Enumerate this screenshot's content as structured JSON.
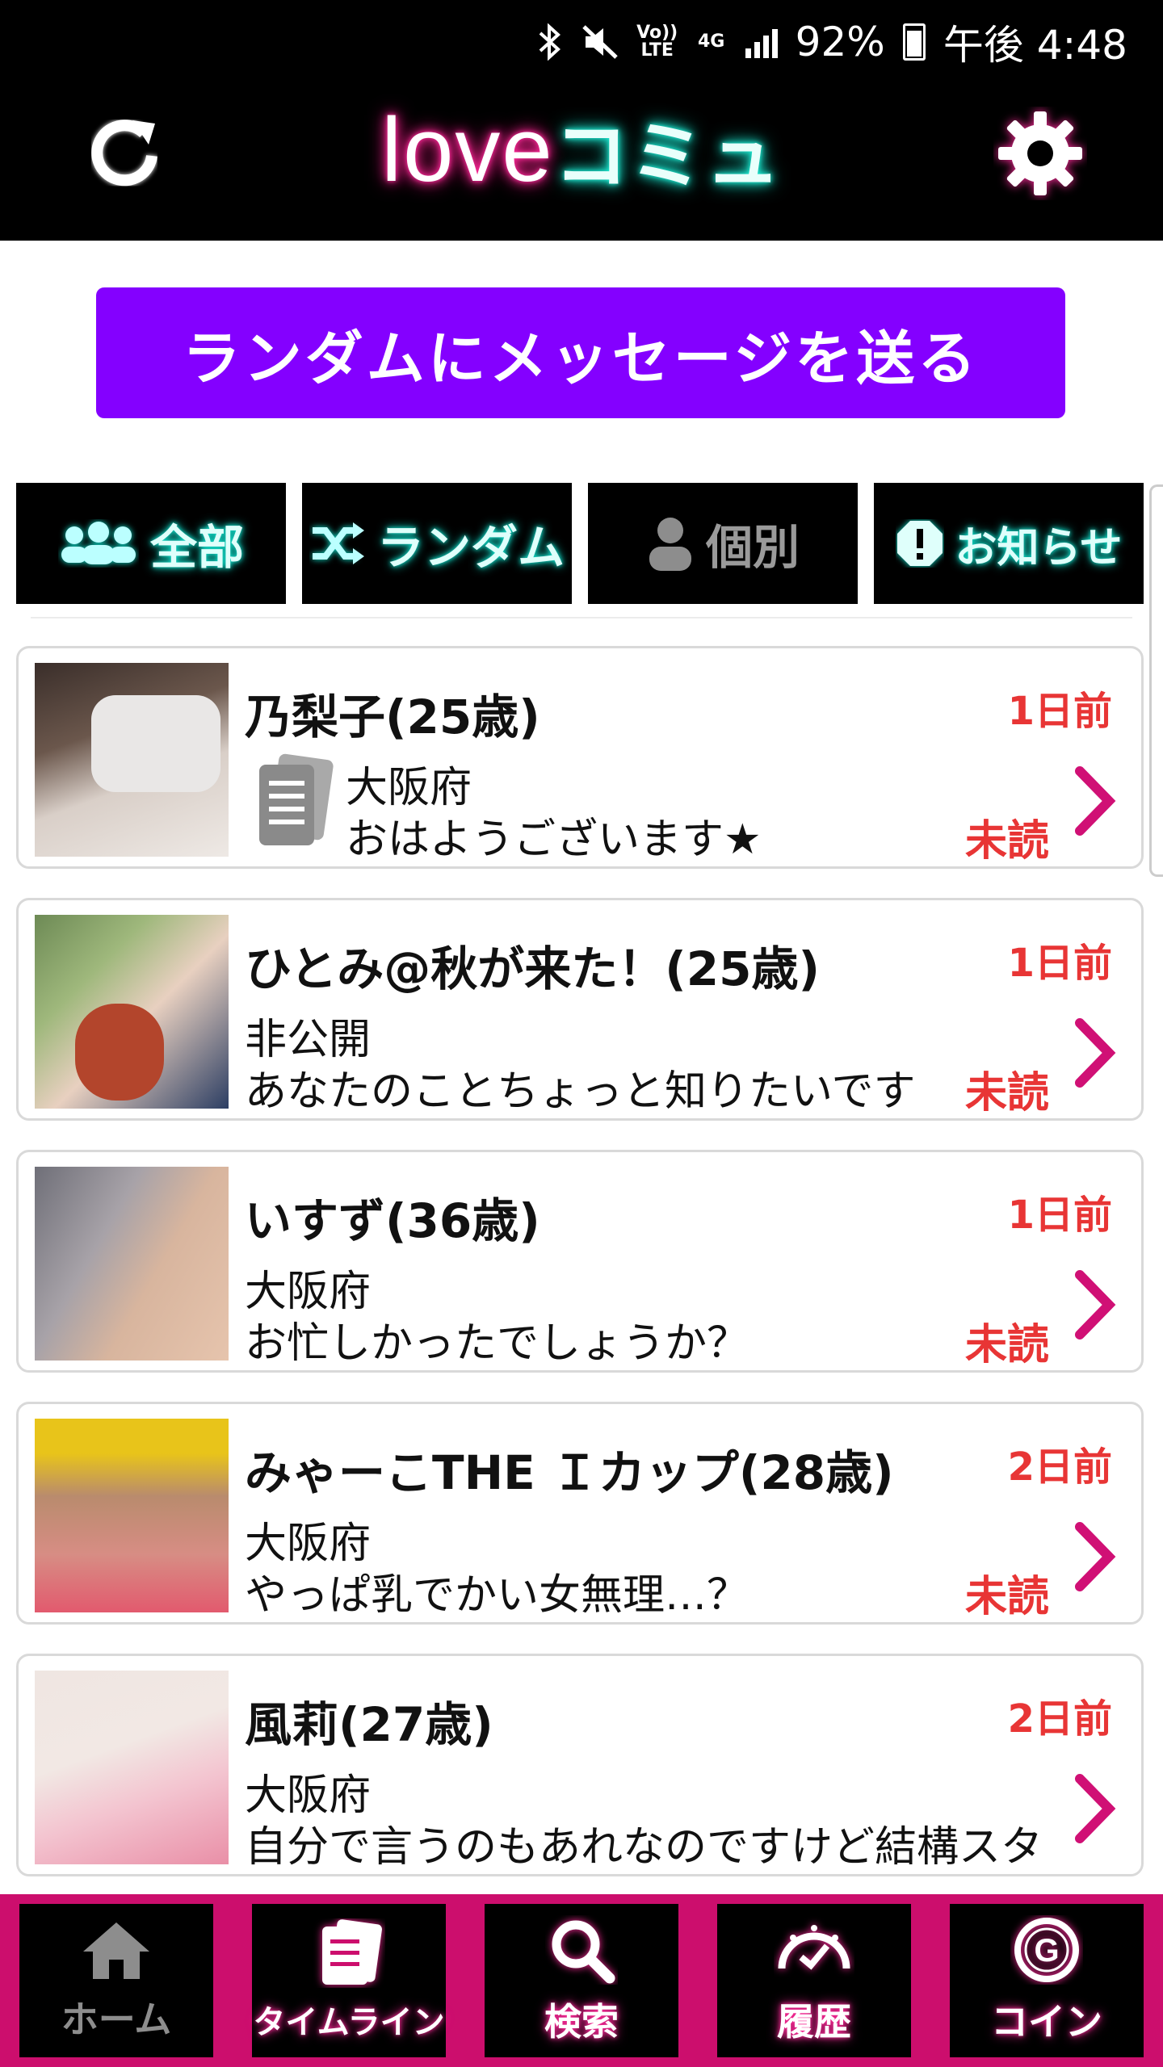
{
  "status_bar": {
    "network_lte": "Vo)) LTE",
    "network_4g": "4G",
    "battery": "92%",
    "time": "午後 4:48",
    "icons": [
      "bluetooth-icon",
      "mute-icon",
      "signal-icon",
      "battery-icon"
    ]
  },
  "header": {
    "logo_love": "LOVE",
    "logo_comu": "コミュ",
    "refresh_icon": "refresh-icon",
    "settings_icon": "gear-icon"
  },
  "random_button": {
    "label": "ランダムにメッセージを送る",
    "color": "#8400ff"
  },
  "tabs": [
    {
      "label": "全部",
      "icon": "group-icon",
      "style": "active-neon"
    },
    {
      "label": "ランダム",
      "icon": "shuffle-icon",
      "style": "active-neon"
    },
    {
      "label": "個別",
      "icon": "person-icon",
      "style": "inactive"
    },
    {
      "label": "お知らせ",
      "icon": "alert-icon",
      "style": "active-neon"
    }
  ],
  "messages": [
    {
      "name": "乃梨子(25歳)",
      "time": "1日前",
      "location": "大阪府",
      "text": "おはようございます★",
      "unread": "未読",
      "has_memo_icon": true
    },
    {
      "name": "ひとみ@秋が来た！(25歳)",
      "time": "1日前",
      "location": "非公開",
      "text": "あなたのことちょっと知りたいです",
      "unread": "未読",
      "has_memo_icon": false
    },
    {
      "name": "いすず(36歳)",
      "time": "1日前",
      "location": "大阪府",
      "text": "お忙しかったでしょうか？",
      "unread": "未読",
      "has_memo_icon": false
    },
    {
      "name": "みゃーこTHE Ｉカップ(28歳)",
      "time": "2日前",
      "location": "大阪府",
      "text": "やっぱ乳でかい女無理…？",
      "unread": "未読",
      "has_memo_icon": false
    },
    {
      "name": "風莉(27歳)",
      "time": "2日前",
      "location": "大阪府",
      "text": "自分で言うのもあれなのですけど結構スタ",
      "unread": "",
      "has_memo_icon": false
    }
  ],
  "bottom_nav": [
    {
      "label": "ホーム",
      "icon": "home-icon",
      "active": false
    },
    {
      "label": "タイムライン",
      "icon": "timeline-icon",
      "active": true
    },
    {
      "label": "検索",
      "icon": "search-icon",
      "active": true
    },
    {
      "label": "履歴",
      "icon": "history-icon",
      "active": true
    },
    {
      "label": "コイン",
      "icon": "coin-icon",
      "active": true
    }
  ],
  "colors": {
    "accent_pink": "#cc0e6d",
    "neon_cyan": "#12e6d2",
    "neon_pink": "#ff2a9a",
    "time_red": "#e83535"
  }
}
